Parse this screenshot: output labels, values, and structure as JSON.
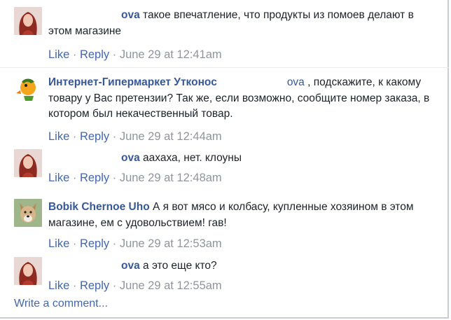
{
  "comments": [
    {
      "author_visible": "ova",
      "lines": [
        "такое впечатление, что продукты из помоев делают в",
        "этом магазине"
      ],
      "actions": {
        "like": "Like",
        "reply": "Reply",
        "time": "June 29 at 12:41am"
      },
      "avatar": "woman-redhair-avatar"
    },
    {
      "author": "Интернет-Гипермаркет Утконос",
      "mention_visible": "ova",
      "lines": [
        ", подскажите, к какому",
        "товару у Вас претензии? Так же, если возможно, сообщите номер заказа, в",
        "котором был некачественный товар."
      ],
      "actions": {
        "like": "Like",
        "reply": "Reply",
        "time": "June 29 at 12:44am"
      },
      "avatar": "utkonos-duck-logo"
    },
    {
      "author_visible": "ova",
      "lines": [
        "аахаха, нет. клоуны"
      ],
      "actions": {
        "like": "Like",
        "reply": "Reply",
        "time": "June 29 at 12:48am"
      },
      "avatar": "woman-redhair-avatar"
    },
    {
      "author": "Bobik Chernoe Uho",
      "lines": [
        "А я вот мясо и колбасу, купленные хозяином в этом",
        "магазине, ем с удовольствием! гав!"
      ],
      "actions": {
        "like": "Like",
        "reply": "Reply",
        "time": "June 29 at 12:53am"
      },
      "avatar": "dog-avatar"
    },
    {
      "author_visible": "ova",
      "lines": [
        "а это еще кто?"
      ],
      "actions": {
        "like": "Like",
        "reply": "Reply",
        "time": "June 29 at 12:55am"
      },
      "avatar": "woman-redhair-avatar"
    }
  ],
  "write_comment": "Write a comment...",
  "colors": {
    "link": "#4267b2",
    "name": "#365899",
    "meta": "#90949c",
    "text": "#1d2129"
  }
}
